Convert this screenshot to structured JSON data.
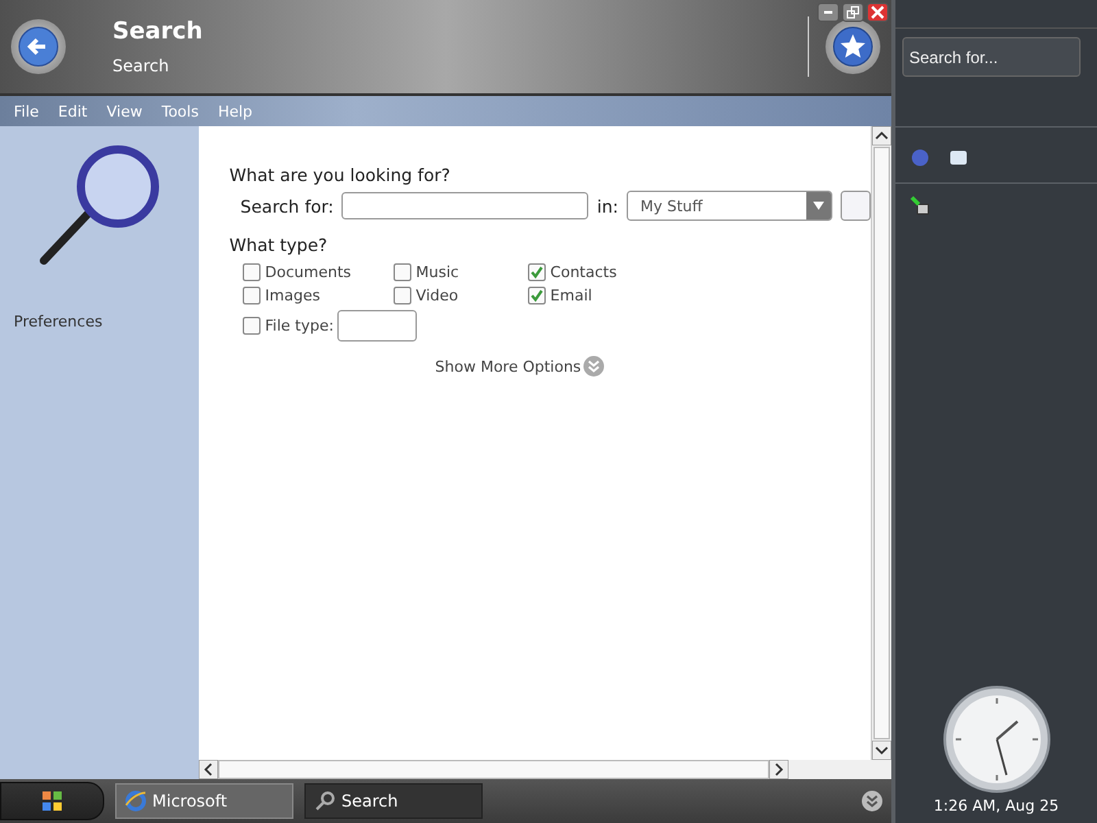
{
  "window": {
    "title": "Search",
    "subtitle": "Search"
  },
  "menu": [
    "File",
    "Edit",
    "View",
    "Tools",
    "Help"
  ],
  "left_pane": {
    "link": "Preferences"
  },
  "search": {
    "heading": "What are you looking for?",
    "label": "Search for:",
    "in_label": "in:",
    "scope": "My Stuff"
  },
  "types": {
    "heading": "What type?",
    "options": [
      {
        "label": "Documents",
        "checked": false
      },
      {
        "label": "Music",
        "checked": false
      },
      {
        "label": "Contacts",
        "checked": true
      },
      {
        "label": "Images",
        "checked": false
      },
      {
        "label": "Video",
        "checked": false
      },
      {
        "label": "Email",
        "checked": true
      }
    ],
    "file_type": {
      "label": "File type:",
      "checked": false
    }
  },
  "more_options": "Show More Options",
  "taskbar": [
    {
      "label": "Microsoft",
      "selected": false
    },
    {
      "label": "Search",
      "selected": true
    }
  ],
  "sidebar": {
    "search": {
      "placeholder": "Search for..."
    },
    "clock": "1:26 AM, Aug 25"
  }
}
